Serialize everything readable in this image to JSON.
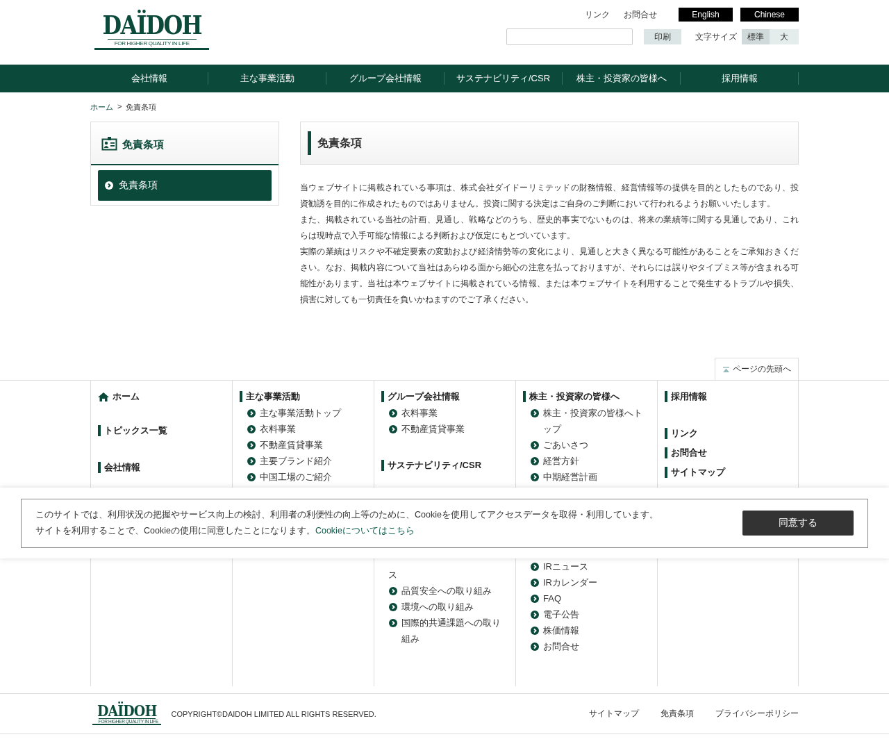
{
  "header": {
    "logo": {
      "name": "DAÏDOH",
      "tagline": "FOR HIGHER QUALITY IN LIFE"
    },
    "top_links": [
      "リンク",
      "お問合せ"
    ],
    "language_buttons": [
      "English",
      "Chinese"
    ],
    "print_button": "印刷",
    "font_size": {
      "label": "文字サイズ",
      "options": [
        {
          "label": "標準",
          "selected": true
        },
        {
          "label": "大",
          "selected": false
        }
      ]
    }
  },
  "global_nav": [
    "会社情報",
    "主な事業活動",
    "グループ会社情報",
    "サステナビリティ/CSR",
    "株主・投資家の皆様へ",
    "採用情報"
  ],
  "breadcrumb": [
    {
      "label": "ホーム",
      "link": true,
      "separator": ">"
    },
    {
      "label": "免責条項",
      "link": false
    }
  ],
  "sidebar": {
    "title": "免責条項",
    "items": [
      {
        "label": "免責条項",
        "selected": true
      }
    ]
  },
  "content": {
    "title": "免責条項",
    "paragraphs": [
      "当ウェブサイトに掲載されている事項は、株式会社ダイドーリミテッドの財務情報、経営情報等の提供を目的としたものであり、投資勧誘を目的に作成されたものではありません。投資に関する決定はご自身のご判断において行われるようお願いいたします。",
      "また、掲載されている当社の計画、見通し、戦略などのうち、歴史的事実でないものは、将来の業績等に関する見通しであり、これらは現時点で入手可能な情報による判断および仮定にもとづいています。",
      "実際の業績はリスクや不確定要素の変動および経済情勢等の変化により、見通しと大きく異なる可能性があることをご承知おきください。なお、掲載内容について当社はあらゆる面から細心の注意を払っておりますが、それらには誤りやタイプミス等が含まれる可能性があります。当社は本ウェブサイトに掲載されている情報、または本ウェブサイトを利用することで発生するトラブルや損失、損害に対しても一切責任を負いかねますのでご了承ください。"
    ]
  },
  "page_top": "ページの先頭へ",
  "footer_nav": {
    "columns": [
      {
        "sections": [
          {
            "kind": "home",
            "title": "ホーム"
          },
          {
            "kind": "heading",
            "title": "トピックス一覧"
          },
          {
            "kind": "heading",
            "title": "会社情報"
          }
        ]
      },
      {
        "sections": [
          {
            "kind": "heading",
            "title": "主な事業活動",
            "items": [
              "主な事業活動トップ",
              "衣料事業",
              "不動産賃貸事業",
              "主要ブランド紹介",
              "中国工場のご紹介"
            ]
          }
        ]
      },
      {
        "sections": [
          {
            "kind": "heading",
            "title": "グループ会社情報",
            "items": [
              "衣料事業",
              "不動産賃貸事業"
            ]
          },
          {
            "kind": "heading",
            "title": "サステナビリティ/CSR"
          }
        ],
        "continued": {
          "fragment": "ス",
          "items": [
            "品質安全への取り組み",
            "環境への取り組み",
            "国際的共通課題への取り組み"
          ]
        }
      },
      {
        "sections": [
          {
            "kind": "heading",
            "title": "株主・投資家の皆様へ",
            "items": [
              "株主・投資家の皆様へトップ",
              "ごあいさつ",
              "経営方針",
              "中期経営計画"
            ]
          }
        ],
        "continued": {
          "items": [
            "IRニュース",
            "IRカレンダー",
            "FAQ",
            "電子公告",
            "株価情報",
            "お問合せ"
          ]
        }
      },
      {
        "sections": [
          {
            "kind": "heading",
            "title": "採用情報"
          },
          {
            "kind": "compact",
            "title": "リンク"
          },
          {
            "kind": "compact",
            "title": "お問合せ"
          },
          {
            "kind": "compact",
            "title": "サイトマップ"
          }
        ]
      }
    ]
  },
  "cookie_banner": {
    "lines": [
      "このサイトでは、利用状況の把握やサービス向上の検討、利用者の利便性の向上等のために、Cookieを使用してアクセスデータを取得・利用しています。",
      "サイトを利用することで、Cookieの使用に同意したことになります。"
    ],
    "link": "Cookieについてはこちら",
    "button": "同意する"
  },
  "footer": {
    "logo": {
      "name": "DAÏDOH",
      "tagline": "FOR HIGHER QUALITY IN LIFE"
    },
    "copyright": "COPYRIGHT©DAIDOH LIMITED ALL RIGHTS RESERVED.",
    "links": [
      "サイトマップ",
      "免責条項",
      "プライバシーポリシー"
    ]
  }
}
